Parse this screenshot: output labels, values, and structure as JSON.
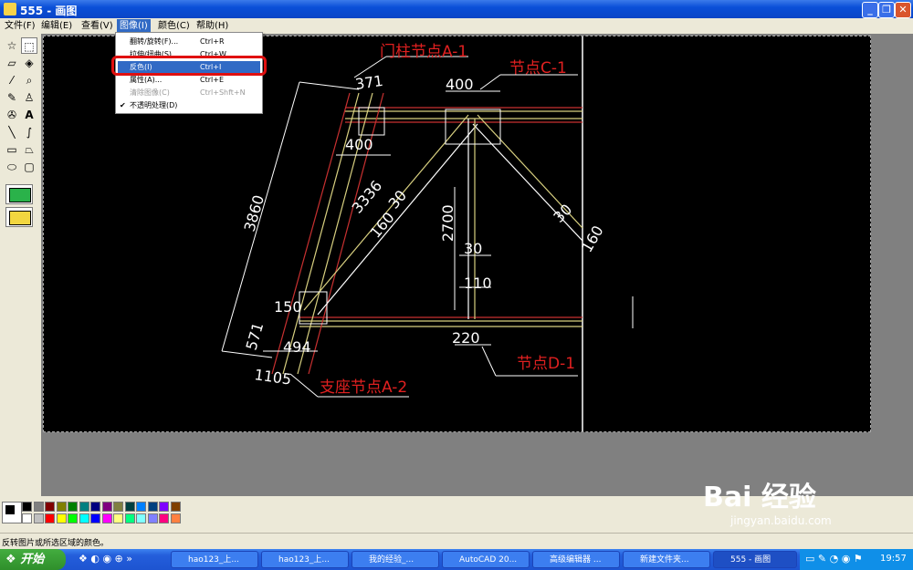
{
  "window": {
    "title": "555 - 画图"
  },
  "menubar": [
    {
      "label": "文件(F)"
    },
    {
      "label": "编辑(E)"
    },
    {
      "label": "查看(V)"
    },
    {
      "label": "图像(I)"
    },
    {
      "label": "颜色(C)"
    },
    {
      "label": "帮助(H)"
    }
  ],
  "image_menu": [
    {
      "label": "翻转/旋转(F)...",
      "shortcut": "Ctrl+R",
      "state": "normal"
    },
    {
      "label": "拉伸/扭曲(S)...",
      "shortcut": "Ctrl+W",
      "state": "normal"
    },
    {
      "label": "反色(I)",
      "shortcut": "Ctrl+I",
      "state": "highlighted"
    },
    {
      "label": "属性(A)...",
      "shortcut": "Ctrl+E",
      "state": "normal"
    },
    {
      "label": "清除图像(C)",
      "shortcut": "Ctrl+Shft+N",
      "state": "disabled"
    },
    {
      "label": "不透明处理(D)",
      "shortcut": "",
      "state": "checked"
    }
  ],
  "drawing": {
    "labels": {
      "node_a1": "门柱节点A-1",
      "node_c1": "节点C-1",
      "node_d1": "节点D-1",
      "node_a2": "支座节点A-2"
    },
    "dims": [
      "371",
      "400",
      "400",
      "3860",
      "3336",
      "30",
      "160",
      "2700",
      "30",
      "30",
      "160",
      "110",
      "150",
      "571",
      "494",
      "220",
      "1105"
    ]
  },
  "status": {
    "text": "反转图片或所选区域的颜色。"
  },
  "taskbar": {
    "start": "开始",
    "items": [
      {
        "label": "hao123_上..."
      },
      {
        "label": "hao123_上..."
      },
      {
        "label": "我的经验_..."
      },
      {
        "label": "AutoCAD 20..."
      },
      {
        "label": "高级编辑器 ..."
      },
      {
        "label": "新建文件夹..."
      },
      {
        "label": "555 - 画图"
      }
    ],
    "clock": "19:57"
  },
  "watermark": {
    "brand": "Bai 经验",
    "url": "jingyan.baidu.com"
  },
  "palette": {
    "top": [
      "#000000",
      "#808080",
      "#800000",
      "#808000",
      "#008000",
      "#008080",
      "#000080",
      "#800080",
      "#808040",
      "#004040",
      "#0080ff",
      "#004080",
      "#8000ff",
      "#804000"
    ],
    "bottom": [
      "#ffffff",
      "#c0c0c0",
      "#ff0000",
      "#ffff00",
      "#00ff00",
      "#00ffff",
      "#0000ff",
      "#ff00ff",
      "#ffff80",
      "#00ff80",
      "#80ffff",
      "#8080ff",
      "#ff0080",
      "#ff8040"
    ]
  }
}
